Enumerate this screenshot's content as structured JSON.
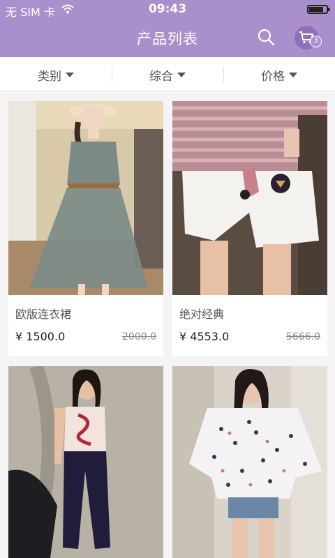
{
  "status_bar": {
    "carrier": "无 SIM 卡",
    "time": "09:43"
  },
  "header": {
    "title": "产品列表",
    "search_icon": "search-icon",
    "cart_icon": "cart-icon",
    "cart_count": "3"
  },
  "filters": [
    {
      "label": "类别"
    },
    {
      "label": "综合"
    },
    {
      "label": "价格"
    }
  ],
  "products": [
    {
      "name": "欧版连衣裙",
      "price": "¥ 1500.0",
      "old_price": "2000.0"
    },
    {
      "name": "绝对经典",
      "price": "¥ 4553.0",
      "old_price": "5666.0"
    }
  ],
  "colors": {
    "header_bg": "#a98fcb",
    "cart_circle": "#8f6fb9"
  }
}
